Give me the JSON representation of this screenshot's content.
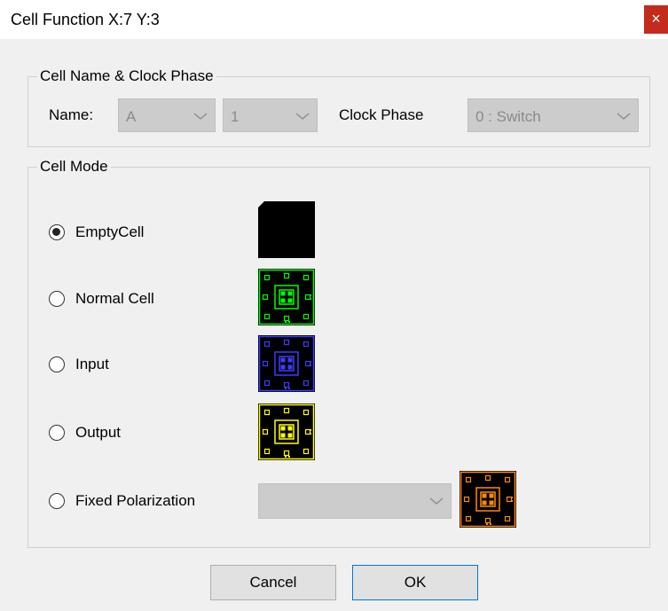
{
  "window": {
    "title": "Cell Function   X:7   Y:3",
    "close_glyph": "×"
  },
  "name_group": {
    "legend": "Cell Name & Clock Phase",
    "name_label": "Name:",
    "name_letter": "A",
    "name_number": "1",
    "clock_label": "Clock Phase",
    "clock_value": "0 : Switch"
  },
  "mode_group": {
    "legend": "Cell Mode",
    "options": [
      {
        "label": "EmptyCell",
        "checked": true
      },
      {
        "label": "Normal Cell",
        "checked": false
      },
      {
        "label": "Input",
        "checked": false
      },
      {
        "label": "Output",
        "checked": false
      },
      {
        "label": "Fixed Polarization",
        "checked": false
      }
    ],
    "fixed_value": ""
  },
  "cell_colors": {
    "empty": "#000000",
    "normal": "#00ff00",
    "input": "#3c3cff",
    "output": "#ffff00",
    "fixed": "#ff8c00"
  },
  "buttons": {
    "cancel": "Cancel",
    "ok": "OK"
  }
}
